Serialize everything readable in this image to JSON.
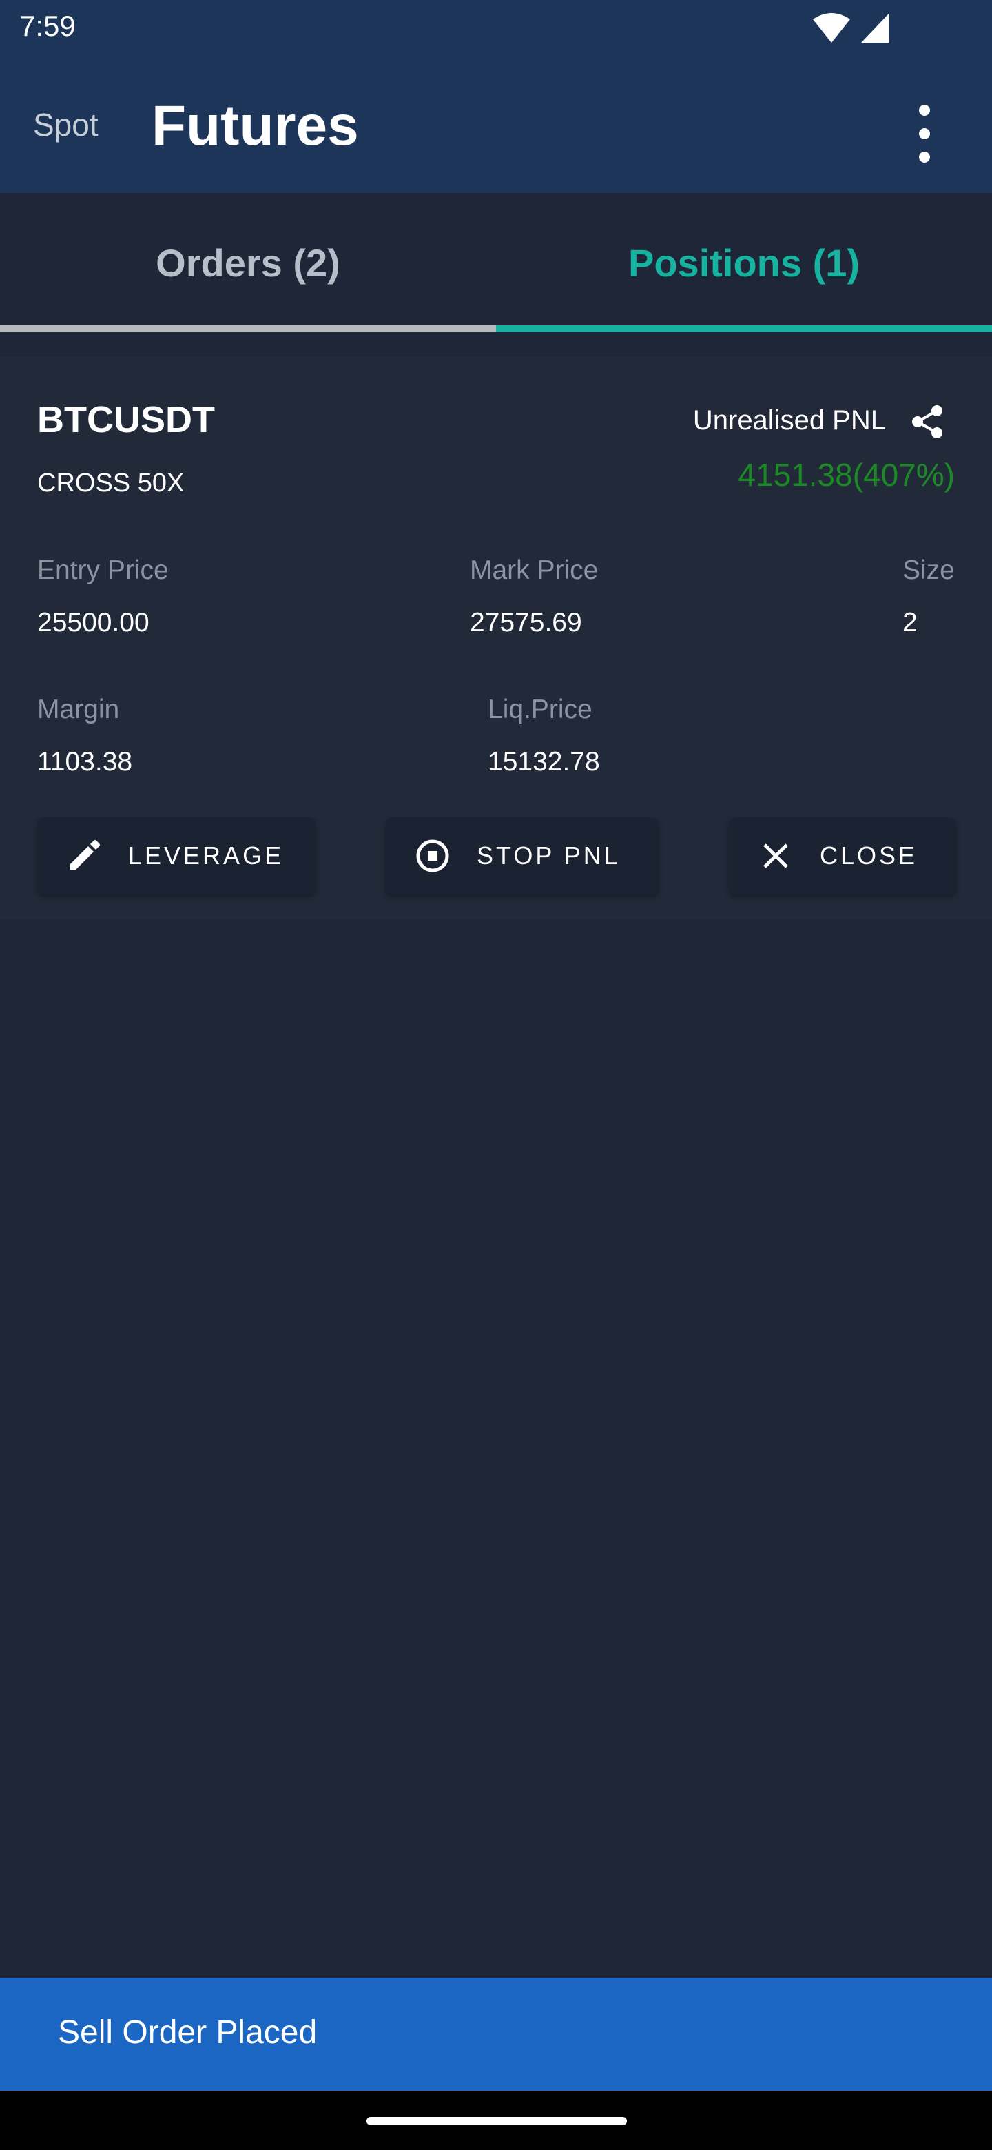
{
  "status_bar": {
    "time": "7:59"
  },
  "app_bar": {
    "spot_label": "Spot",
    "title": "Futures"
  },
  "tabs": [
    {
      "label": "Orders (2)",
      "active": false
    },
    {
      "label": "Positions (1)",
      "active": true
    }
  ],
  "position": {
    "symbol": "BTCUSDT",
    "mode": "CROSS 50X",
    "pnl_label": "Unrealised PNL",
    "pnl_value": "4151.38(407%)",
    "entry_price_label": "Entry Price",
    "entry_price": "25500.00",
    "mark_price_label": "Mark Price",
    "mark_price": "27575.69",
    "size_label": "Size",
    "size": "2",
    "margin_label": "Margin",
    "margin": "1103.38",
    "liq_price_label": "Liq.Price",
    "liq_price": "15132.78"
  },
  "actions": {
    "leverage_label": "LEVERAGE",
    "stop_pnl_label": "STOP PNL",
    "close_label": "CLOSE"
  },
  "toast": {
    "message": "Sell Order Placed"
  },
  "icons": [
    "wifi-icon",
    "signal-icon",
    "more-vert-icon",
    "share-icon",
    "pencil-icon",
    "stop-circle-icon",
    "close-icon"
  ],
  "colors": {
    "app_bar": "#1c3559",
    "accent": "#16b4a0",
    "profit": "#1b8a25",
    "toast": "#1b66c2",
    "background": "#1f2637"
  }
}
